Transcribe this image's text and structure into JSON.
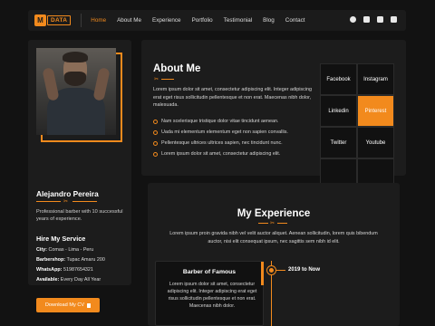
{
  "brand": {
    "logo_mark": "M",
    "logo_text": "DATA"
  },
  "nav": {
    "links": [
      {
        "label": "Home",
        "active": true
      },
      {
        "label": "About Me",
        "active": false
      },
      {
        "label": "Experience",
        "active": false
      },
      {
        "label": "Portfolio",
        "active": false
      },
      {
        "label": "Testimonial",
        "active": false
      },
      {
        "label": "Blog",
        "active": false
      },
      {
        "label": "Contact",
        "active": false
      }
    ],
    "social_icons": [
      "facebook-icon",
      "twitter-icon",
      "linkedin-icon",
      "instagram-icon"
    ]
  },
  "profile": {
    "name": "Alejandro Pereira",
    "description": "Professional barber with 10 successful years of experience.",
    "hire_title": "Hire My Service",
    "info": [
      {
        "label": "City:",
        "value": "Comas - Lima - Peru"
      },
      {
        "label": "Barbershop:",
        "value": "Tupac Amaru 200"
      },
      {
        "label": "WhatsApp:",
        "value": "51987654321"
      },
      {
        "label": "Available:",
        "value": "Every Day All Year"
      }
    ],
    "cv_button": "Download My CV"
  },
  "about": {
    "title": "About Me",
    "text": "Lorem ipsum dolor sit amet, consectetur adipiscing elit. Integer adipiscing erat eget risus sollicitudin pellentesque et non erat. Maecenas nibh dolor, malesuada.",
    "list": [
      "Nam scelerisque tristique dolor vitae tincidunt aenean.",
      "Uada mi elementum elementum eget non sapien convallis.",
      "Pellentesque ultrices ultrices sapien, nec tincidunt nunc.",
      "Lorem ipsum dolor sit amet, consectetur adipiscing elit."
    ]
  },
  "social_grid": [
    {
      "label": "Facebook",
      "active": false
    },
    {
      "label": "Instagram",
      "active": false
    },
    {
      "label": "Linkedin",
      "active": false
    },
    {
      "label": "Pinterest",
      "active": true
    },
    {
      "label": "Twitter",
      "active": false
    },
    {
      "label": "Youtube",
      "active": false
    },
    {
      "label": "",
      "active": false
    },
    {
      "label": "",
      "active": false
    }
  ],
  "experience": {
    "title": "My Experience",
    "text": "Lorem ipsum proin gravida nibh vel velit auctor aliquet. Aenean sollicitudin, lorem quis bibendum auctor, nisi elit consequat ipsum, nec sagittis sem nibh id elit.",
    "items": [
      {
        "role": "Barber of Famous",
        "description": "Lorem ipsum dolor sit amet, consectetur adipiscing elit. Integer adipiscing erat eget risus sollicitudin pellentesque et non erat. Maecenas nibh dolor.",
        "date": "2019 to Now"
      }
    ]
  },
  "colors": {
    "accent": "#f28a1d",
    "background": "#121212",
    "panel": "#1c1c1c"
  }
}
